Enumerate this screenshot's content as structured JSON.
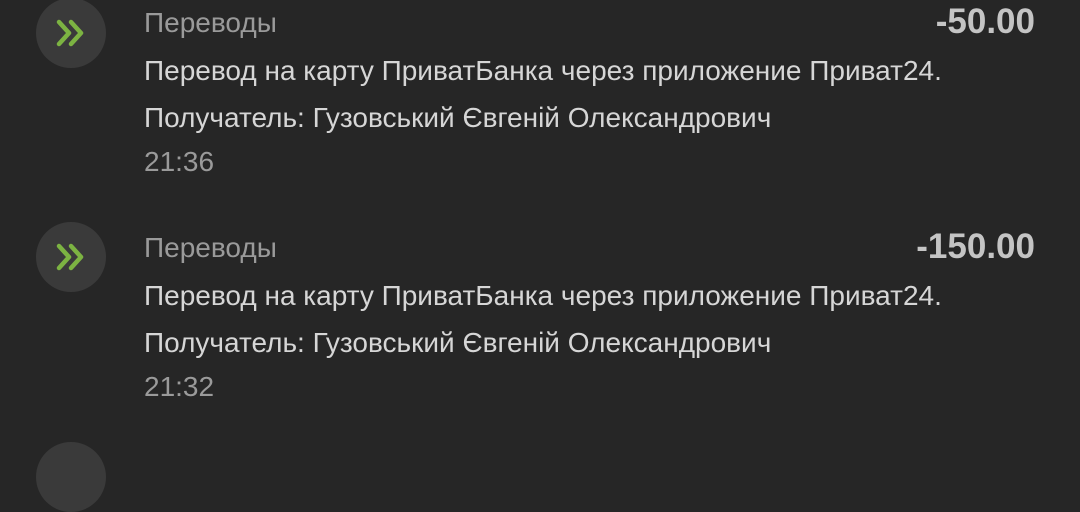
{
  "transactions": [
    {
      "category": "Переводы",
      "amount": "-50.00",
      "description_line1": "Перевод на карту ПриватБанка через приложение Приват24.",
      "description_line2": "Получатель: Гузовський Євгеній Олександрович",
      "time": "21:36",
      "icon": "transfer-chevrons-icon"
    },
    {
      "category": "Переводы",
      "amount": "-150.00",
      "description_line1": "Перевод на карту ПриватБанка через приложение Приват24.",
      "description_line2": "Получатель: Гузовський Євгеній Олександрович",
      "time": "21:32",
      "icon": "transfer-chevrons-icon"
    }
  ],
  "colors": {
    "background": "#262626",
    "icon_circle": "#3a3a3a",
    "icon_accent": "#7cb342",
    "secondary_text": "#9a9a9a",
    "primary_text": "#d6d6d6",
    "amount_text": "#c4c4c4"
  }
}
